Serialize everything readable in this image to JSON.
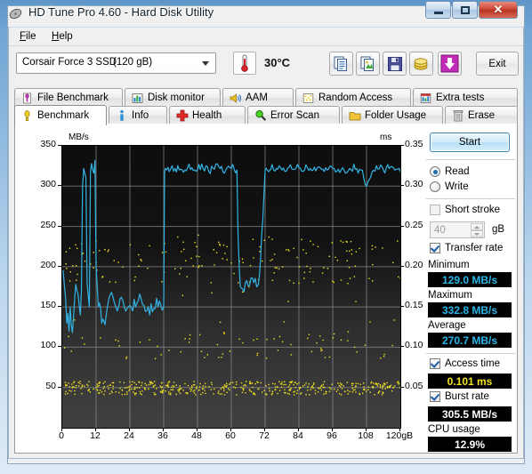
{
  "window": {
    "title": "HD Tune Pro 4.60 - Hard Disk Utility",
    "title_icon": "hdtune-icon",
    "minimize_label": "",
    "maximize_label": "",
    "close_label": "✕"
  },
  "menu": [
    {
      "label": "File",
      "underline": "F"
    },
    {
      "label": "Help",
      "underline": "H"
    }
  ],
  "toolbar": {
    "drive_name": "Corsair Force 3 SSD",
    "drive_size": "(120 gB)",
    "temperature": "30°C",
    "temp_icon": "thermometer-icon",
    "buttons": [
      {
        "name": "copy-text-icon",
        "title": "Copy text"
      },
      {
        "name": "copy-image-icon",
        "title": "Copy image"
      },
      {
        "name": "save-icon",
        "title": "Save"
      },
      {
        "name": "coins-icon",
        "title": "Donate"
      },
      {
        "name": "download-icon",
        "title": "Download"
      }
    ],
    "exit_label": "Exit"
  },
  "tabs_top": [
    {
      "label": "File Benchmark",
      "icon": "file-benchmark-icon",
      "active": false
    },
    {
      "label": "Disk monitor",
      "icon": "disk-monitor-icon",
      "active": false
    },
    {
      "label": "AAM",
      "icon": "speaker-icon",
      "active": false
    },
    {
      "label": "Random Access",
      "icon": "random-access-icon",
      "active": false
    },
    {
      "label": "Extra tests",
      "icon": "extra-tests-icon",
      "active": false
    }
  ],
  "tabs_bottom": [
    {
      "label": "Benchmark",
      "icon": "benchmark-icon",
      "active": true
    },
    {
      "label": "Info",
      "icon": "info-icon",
      "active": false
    },
    {
      "label": "Health",
      "icon": "health-icon",
      "active": false
    },
    {
      "label": "Error Scan",
      "icon": "error-scan-icon",
      "active": false
    },
    {
      "label": "Folder Usage",
      "icon": "folder-usage-icon",
      "active": false
    },
    {
      "label": "Erase",
      "icon": "erase-icon",
      "active": false
    }
  ],
  "side": {
    "start_label": "Start",
    "mode_read": "Read",
    "mode_write": "Write",
    "mode_selected": "Read",
    "short_stroke_label": "Short stroke",
    "short_stroke_checked": false,
    "short_stroke_value": "40",
    "short_stroke_unit": "gB",
    "transfer_rate_label": "Transfer rate",
    "transfer_rate_checked": true,
    "minimum_label": "Minimum",
    "minimum_value": "129.0 MB/s",
    "maximum_label": "Maximum",
    "maximum_value": "332.8 MB/s",
    "average_label": "Average",
    "average_value": "270.7 MB/s",
    "access_time_label": "Access time",
    "access_time_checked": true,
    "access_time_value": "0.101 ms",
    "burst_rate_label": "Burst rate",
    "burst_rate_checked": true,
    "burst_rate_value": "305.5 MB/s",
    "cpu_usage_label": "CPU usage",
    "cpu_usage_value": "12.9%"
  },
  "colors": {
    "transfer_rate_line": "#32b4e6",
    "access_time_dots": "#f2e31c",
    "plot_background": "#101010",
    "grid": "#8d8d8d",
    "accent_blue": "#1a6fb5"
  },
  "chart_data": {
    "type": "line",
    "title": "",
    "xlabel": "120gB",
    "ylabel": "MB/s",
    "y2label": "ms",
    "xlim": [
      0,
      120
    ],
    "ylim": [
      0,
      350
    ],
    "y2lim": [
      0,
      0.35
    ],
    "grid": true,
    "xticks": [
      0,
      12,
      24,
      36,
      48,
      60,
      72,
      84,
      96,
      108,
      120
    ],
    "xticklabels": [
      "0",
      "12",
      "24",
      "36",
      "48",
      "60",
      "72",
      "84",
      "96",
      "108",
      "120gB"
    ],
    "yticks": [
      50,
      100,
      150,
      200,
      250,
      300,
      350
    ],
    "yticklabels": [
      "50",
      "100",
      "150",
      "200",
      "250",
      "300",
      "350"
    ],
    "y2ticks": [
      0.05,
      0.1,
      0.15,
      0.2,
      0.25,
      0.3,
      0.35
    ],
    "y2ticklabels": [
      "0.05",
      "0.10",
      "0.15",
      "0.20",
      "0.25",
      "0.30",
      "0.35"
    ],
    "series": [
      {
        "name": "Transfer rate",
        "axis": "left",
        "color": "#32b4e6",
        "unit": "MB/s",
        "x": [
          0.3,
          0.8,
          1.2,
          1.6,
          2.0,
          2.4,
          2.8,
          3.2,
          3.6,
          4.0,
          4.4,
          4.8,
          5.2,
          5.6,
          6.0,
          6.4,
          6.8,
          7.2,
          7.6,
          8.0,
          8.4,
          8.8,
          9.2,
          9.6,
          10.0,
          10.4,
          10.8,
          11.2,
          11.6,
          12.0,
          12.4,
          12.8,
          13.2,
          13.6,
          14.0,
          14.4,
          14.8,
          15.2,
          15.6,
          16.0,
          16.5,
          17.0,
          17.5,
          18.0,
          18.5,
          19.0,
          19.5,
          20.0,
          20.5,
          21.0,
          21.5,
          22.0,
          22.5,
          23.0,
          23.5,
          24.0,
          25.0,
          26.0,
          27.0,
          28.0,
          29.0,
          30.0,
          31.0,
          32.0,
          33.0,
          34.0,
          35.0,
          35.5,
          36.0,
          36.3,
          36.6,
          37.0,
          38.0,
          40.0,
          42.0,
          44.0,
          46.0,
          48.0,
          50.0,
          52.0,
          54.0,
          56.0,
          58.0,
          60.0,
          61.0,
          62.0,
          62.4,
          62.8,
          63.2,
          64.0,
          65.0,
          66.0,
          67.0,
          68.0,
          69.0,
          69.6,
          70.0,
          70.4,
          70.8,
          71.2,
          71.6,
          72.0,
          72.4,
          72.8,
          73.2,
          74.0,
          76.0,
          78.0,
          80.0,
          82.0,
          84.0,
          86.0,
          88.0,
          90.0,
          92.0,
          94.0,
          96.0,
          98.0,
          100.0,
          102.0,
          104.0,
          106.0,
          108.0,
          110.0,
          112.0,
          114.0,
          116.0,
          118.0,
          119.0,
          119.6,
          120.0
        ],
        "y": [
          195,
          175,
          160,
          130,
          142,
          120,
          150,
          128,
          118,
          138,
          160,
          178,
          170,
          166,
          152,
          140,
          170,
          300,
          322,
          316,
          310,
          180,
          165,
          150,
          318,
          328,
          320,
          316,
          332,
          200,
          175,
          150,
          155,
          148,
          130,
          135,
          132,
          128,
          140,
          150,
          160,
          165,
          168,
          162,
          155,
          150,
          145,
          150,
          160,
          162,
          158,
          150,
          145,
          148,
          150,
          152,
          145,
          150,
          158,
          160,
          152,
          145,
          140,
          144,
          148,
          150,
          152,
          146,
          150,
          318,
          322,
          320,
          318,
          322,
          321,
          319,
          323,
          320,
          322,
          318,
          321,
          322,
          320,
          322,
          321,
          320,
          240,
          200,
          175,
          172,
          180,
          176,
          186,
          180,
          175,
          178,
          190,
          210,
          240,
          260,
          290,
          320,
          322,
          320,
          318,
          321,
          322,
          320,
          322,
          321,
          323,
          320,
          322,
          319,
          321,
          320,
          322,
          321,
          320,
          322,
          321,
          320,
          300,
          318,
          321,
          320,
          322,
          320,
          321,
          322,
          318
        ]
      },
      {
        "name": "Access time",
        "axis": "right",
        "color": "#f2e31c",
        "unit": "ms",
        "scatter": true,
        "note": "dense band around 0.045-0.055 ms plus scattered points between 0.085 and 0.23 ms",
        "band_center": 0.05,
        "band_spread": 0.008,
        "outlier_range": [
          0.08,
          0.235
        ],
        "average": 0.101
      }
    ]
  }
}
